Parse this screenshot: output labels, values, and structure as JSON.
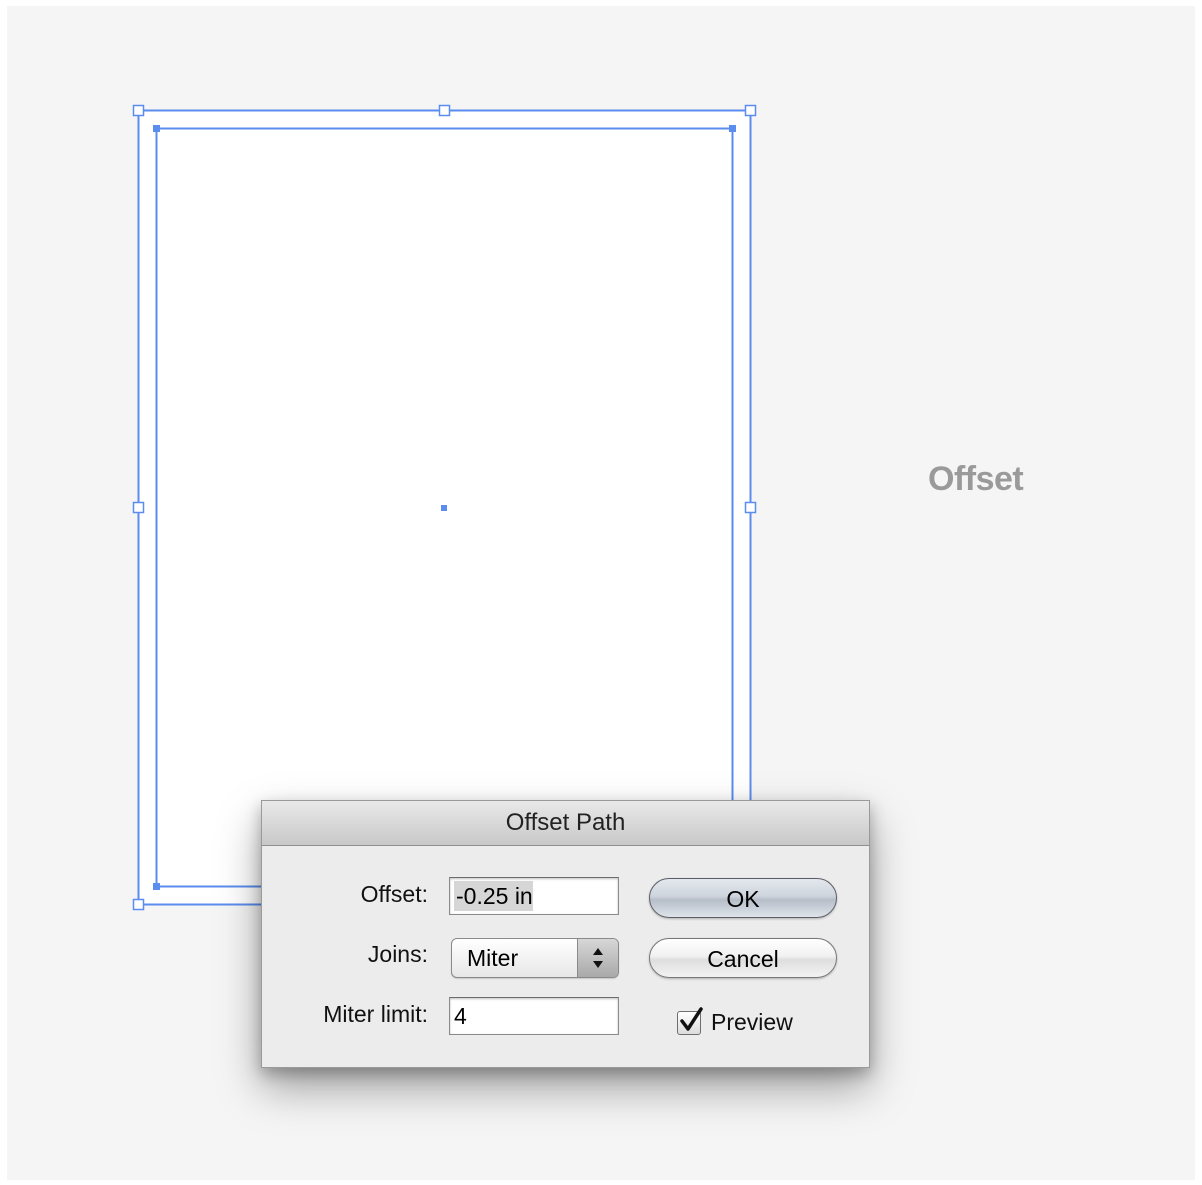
{
  "canvas": {
    "annotation_label": "Offset",
    "selection_color": "#5b8def"
  },
  "dialog": {
    "title": "Offset Path",
    "offset": {
      "label": "Offset:",
      "value": "-0.25 in"
    },
    "joins": {
      "label": "Joins:",
      "selected": "Miter"
    },
    "miter_limit": {
      "label": "Miter limit:",
      "value": "4"
    },
    "buttons": {
      "ok": "OK",
      "cancel": "Cancel"
    },
    "preview": {
      "label": "Preview",
      "checked": true
    }
  }
}
